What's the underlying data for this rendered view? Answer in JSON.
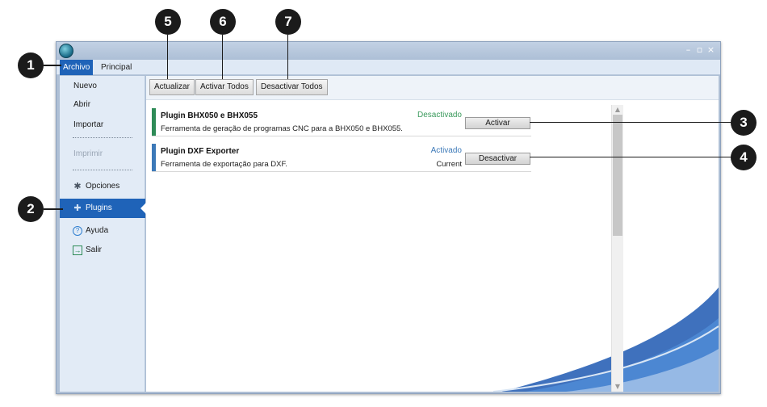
{
  "callouts": {
    "c1": "1",
    "c2": "2",
    "c3": "3",
    "c4": "4",
    "c5": "5",
    "c6": "6",
    "c7": "7"
  },
  "window": {
    "controls": {
      "minimize": "–",
      "maximize": "▫",
      "close": "×"
    }
  },
  "ribbon": {
    "tabs": [
      {
        "label": "Archivo"
      },
      {
        "label": "Principal"
      }
    ]
  },
  "sidebar": {
    "items": [
      {
        "label": "Nuevo"
      },
      {
        "label": "Abrir"
      },
      {
        "label": "Importar"
      },
      {
        "label": "Imprimir"
      },
      {
        "label": "Opciones",
        "icon": "gear-icon"
      },
      {
        "label": "Plugins",
        "icon": "puzzle-icon"
      },
      {
        "label": "Ayuda",
        "icon": "help-icon"
      },
      {
        "label": "Salir",
        "icon": "exit-icon"
      }
    ]
  },
  "toolbar": {
    "refresh_label": "Actualizar",
    "activate_all_label": "Activar Todos",
    "deactivate_all_label": "Desactivar Todos"
  },
  "plugins": [
    {
      "name": "Plugin BHX050 e BHX055",
      "description": "Ferramenta de geração de programas CNC para a BHX050 e BHX055.",
      "status": "Desactivado",
      "version": "",
      "button": "Activar",
      "bar_color": "#2e8b57",
      "status_color": "#3a9a5c"
    },
    {
      "name": "Plugin DXF Exporter",
      "description": "Ferramenta de exportação para DXF.",
      "status": "Activado",
      "version": "Current",
      "button": "Desactivar",
      "bar_color": "#3c79b8",
      "status_color": "#3c79b8"
    }
  ],
  "colors": {
    "accent": "#1f63b8",
    "callout": "#1b1b1b"
  }
}
